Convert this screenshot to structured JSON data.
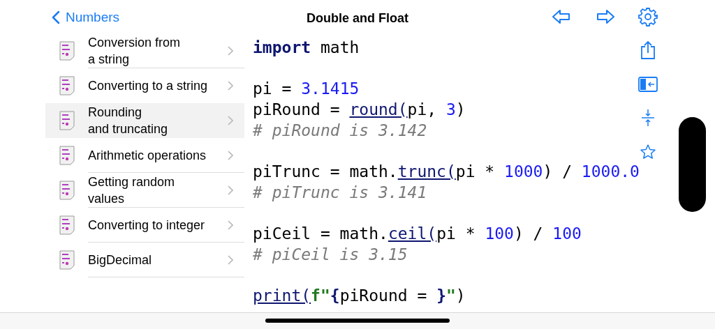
{
  "nav": {
    "back_label": "Numbers",
    "title": "Double and Float"
  },
  "sidebar": {
    "items": [
      {
        "label": "Conversion from\na string",
        "selected": false
      },
      {
        "label": "Converting to a string",
        "selected": false
      },
      {
        "label": "Rounding\nand truncating",
        "selected": true
      },
      {
        "label": "Arithmetic operations",
        "selected": false
      },
      {
        "label": "Getting random\nvalues",
        "selected": false
      },
      {
        "label": "Converting to integer",
        "selected": false
      },
      {
        "label": "BigDecimal",
        "selected": false
      }
    ]
  },
  "code": {
    "lines": [
      {
        "kind": "code",
        "tokens": [
          {
            "kind": "keyword",
            "text": "import"
          },
          {
            "kind": "plain",
            "text": " math"
          }
        ]
      },
      {
        "kind": "blank"
      },
      {
        "kind": "code",
        "tokens": [
          {
            "kind": "plain",
            "text": "pi = "
          },
          {
            "kind": "number",
            "text": "3.1415"
          }
        ]
      },
      {
        "kind": "code",
        "tokens": [
          {
            "kind": "plain",
            "text": "piRound = "
          },
          {
            "kind": "function",
            "text": "round("
          },
          {
            "kind": "plain",
            "text": "pi, "
          },
          {
            "kind": "number",
            "text": "3"
          },
          {
            "kind": "plain",
            "text": ")"
          }
        ]
      },
      {
        "kind": "code",
        "tokens": [
          {
            "kind": "comment",
            "text": "# piRound is 3.142"
          }
        ]
      },
      {
        "kind": "blank"
      },
      {
        "kind": "code",
        "tokens": [
          {
            "kind": "plain",
            "text": "piTrunc = math."
          },
          {
            "kind": "function",
            "text": "trunc("
          },
          {
            "kind": "plain",
            "text": "pi * "
          },
          {
            "kind": "number",
            "text": "1000"
          },
          {
            "kind": "plain",
            "text": ") / "
          },
          {
            "kind": "number",
            "text": "1000.0"
          }
        ]
      },
      {
        "kind": "code",
        "tokens": [
          {
            "kind": "comment",
            "text": "# piTrunc is 3.141"
          }
        ]
      },
      {
        "kind": "blank"
      },
      {
        "kind": "code",
        "tokens": [
          {
            "kind": "plain",
            "text": "piCeil = math."
          },
          {
            "kind": "function",
            "text": "ceil("
          },
          {
            "kind": "plain",
            "text": "pi * "
          },
          {
            "kind": "number",
            "text": "100"
          },
          {
            "kind": "plain",
            "text": ") / "
          },
          {
            "kind": "number",
            "text": "100"
          }
        ]
      },
      {
        "kind": "code",
        "tokens": [
          {
            "kind": "comment",
            "text": "# piCeil is 3.15"
          }
        ]
      },
      {
        "kind": "blank"
      },
      {
        "kind": "code",
        "tokens": [
          {
            "kind": "function",
            "text": "print("
          },
          {
            "kind": "string",
            "text": "f\""
          },
          {
            "kind": "brace",
            "text": "{"
          },
          {
            "kind": "plain",
            "text": "piRound = "
          },
          {
            "kind": "brace",
            "text": "}"
          },
          {
            "kind": "string",
            "text": "\""
          },
          {
            "kind": "plain",
            "text": ")"
          }
        ]
      }
    ]
  }
}
